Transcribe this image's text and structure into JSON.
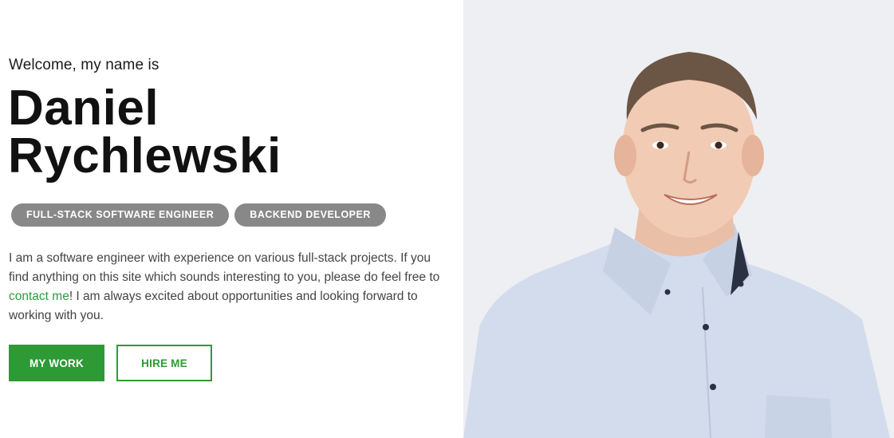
{
  "hero": {
    "welcome": "Welcome, my name is",
    "first_name": "Daniel",
    "last_name": "Rychlewski",
    "tags": [
      "FULL-STACK SOFTWARE ENGINEER",
      "BACKEND DEVELOPER"
    ],
    "bio_part1": "I am a software engineer with experience on various full-stack projects. If you find anything on this site which sounds interesting to you, please do feel free to ",
    "bio_link": "contact me",
    "bio_part2": "! I am always excited about opportunities and looking forward to working with you.",
    "buttons": {
      "my_work": "MY WORK",
      "hire_me": "HIRE ME"
    }
  },
  "colors": {
    "accent": "#2e9a36",
    "tag_bg": "#888888",
    "photo_bg": "#eeeff2",
    "shirt": "#d3dcec"
  }
}
